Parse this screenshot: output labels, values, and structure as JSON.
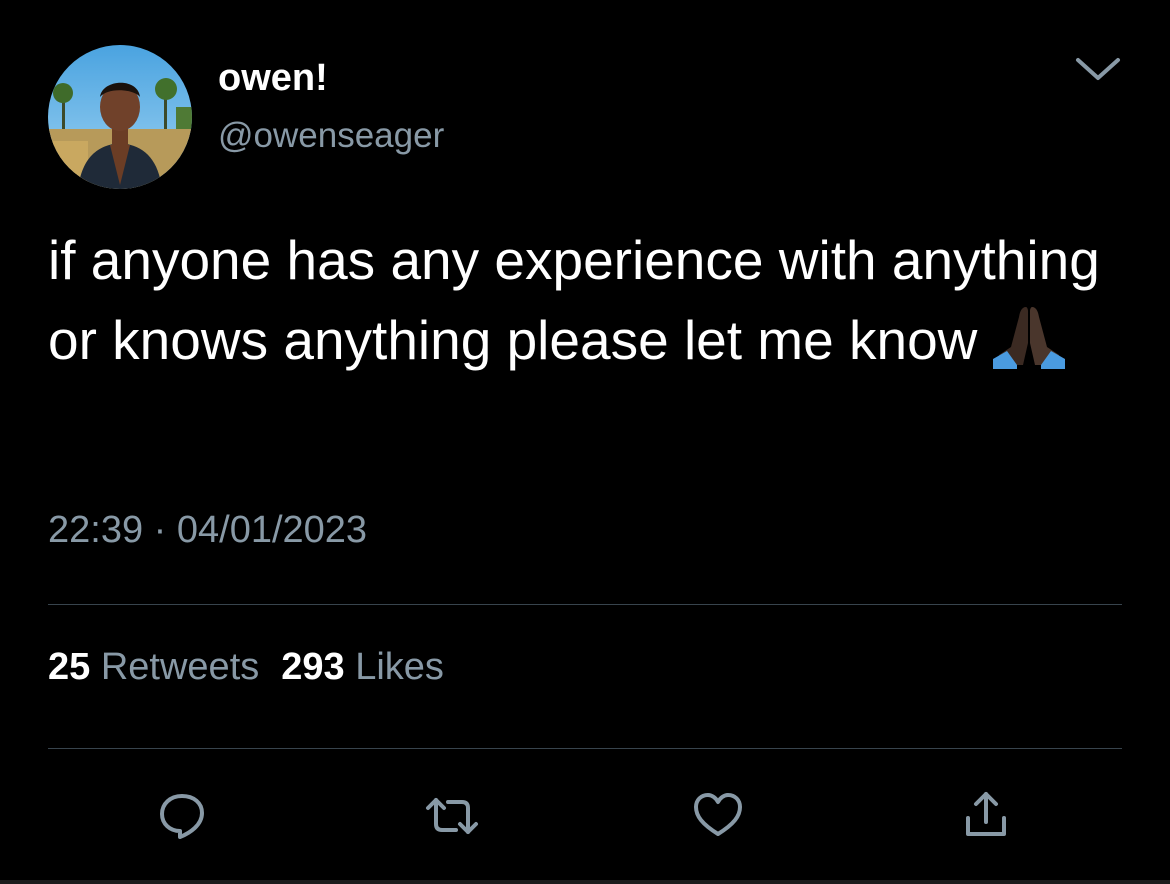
{
  "tweet": {
    "author": {
      "display_name": "owen!",
      "handle": "@owenseager",
      "avatar_icon": "profile-photo"
    },
    "text": "if anyone has any experience with anything or knows anything please let me know",
    "emoji": "folded-hands-dark-skin-tone",
    "time": "22:39",
    "separator": "·",
    "date": "04/01/2023",
    "retweets": {
      "count": "25",
      "label": "Retweets"
    },
    "likes": {
      "count": "293",
      "label": "Likes"
    }
  },
  "actions": [
    {
      "name": "reply",
      "icon": "reply-bubble-icon"
    },
    {
      "name": "retweet",
      "icon": "retweet-icon"
    },
    {
      "name": "like",
      "icon": "heart-icon"
    },
    {
      "name": "share",
      "icon": "share-icon"
    }
  ],
  "menu_icon": "chevron-down-icon",
  "colors": {
    "background": "#000000",
    "primary_text": "#ffffff",
    "secondary_text": "#8899a6",
    "divider": "#38444d"
  }
}
